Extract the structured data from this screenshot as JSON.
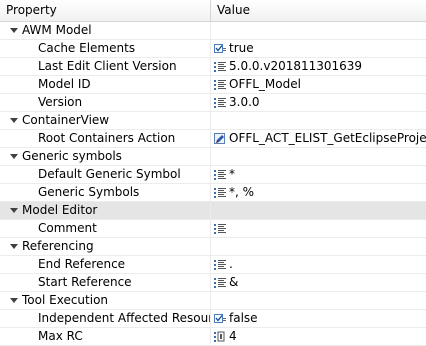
{
  "header": {
    "property": "Property",
    "value": "Value"
  },
  "rows": [
    {
      "kind": "cat",
      "label": "AWM Model"
    },
    {
      "kind": "prop",
      "label": "Cache Elements",
      "icon": "boolean-icon",
      "value": "true"
    },
    {
      "kind": "prop",
      "label": "Last Edit Client Version",
      "icon": "text-icon",
      "value": "5.0.0.v201811301639"
    },
    {
      "kind": "prop",
      "label": "Model ID",
      "icon": "text-icon",
      "value": "OFFL_Model"
    },
    {
      "kind": "prop",
      "label": "Version",
      "icon": "text-icon",
      "value": "3.0.0"
    },
    {
      "kind": "cat",
      "label": "ContainerView"
    },
    {
      "kind": "prop",
      "label": "Root Containers Action",
      "icon": "edit-icon",
      "value": "OFFL_ACT_ELIST_GetEclipseProjects"
    },
    {
      "kind": "cat",
      "label": "Generic symbols"
    },
    {
      "kind": "prop",
      "label": "Default Generic Symbol",
      "icon": "text-icon",
      "value": "*"
    },
    {
      "kind": "prop",
      "label": "Generic Symbols",
      "icon": "text-icon",
      "value": "*, %"
    },
    {
      "kind": "cat",
      "label": "Model Editor",
      "selected": true
    },
    {
      "kind": "prop",
      "label": "Comment",
      "icon": "text-icon",
      "value": ""
    },
    {
      "kind": "cat",
      "label": "Referencing"
    },
    {
      "kind": "prop",
      "label": "End Reference",
      "icon": "text-icon",
      "value": "."
    },
    {
      "kind": "prop",
      "label": "Start Reference",
      "icon": "text-icon",
      "value": "&"
    },
    {
      "kind": "cat",
      "label": "Tool Execution"
    },
    {
      "kind": "prop",
      "label": "Independent Affected Resource Cl",
      "icon": "boolean-icon",
      "value": "false"
    },
    {
      "kind": "prop",
      "label": "Max RC",
      "icon": "number-icon",
      "value": "4"
    }
  ]
}
